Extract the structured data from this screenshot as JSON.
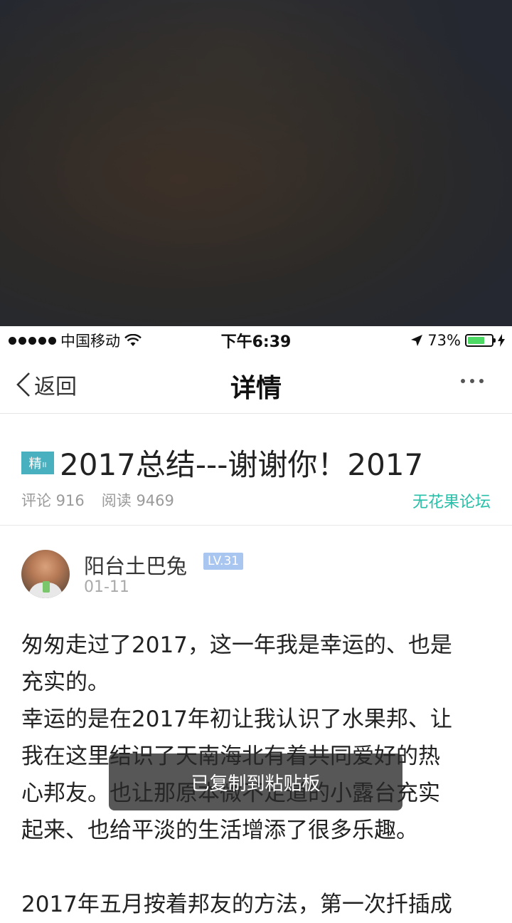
{
  "status_bar": {
    "carrier": "中国移动",
    "time": "下午6:39",
    "battery_percent": "73%",
    "battery_level": 0.73,
    "battery_color": "#4cd964"
  },
  "nav": {
    "back_label": "返回",
    "title": "详情",
    "more_icon": "ellipsis-icon"
  },
  "post": {
    "badge_main": "精",
    "badge_sub": "II",
    "badge_color": "#48b0bf",
    "title": "2017总结---谢谢你！2017",
    "comments_label": "评论 916",
    "reads_label": "阅读 9469",
    "forum": "无花果论坛",
    "forum_color": "#28bfa8"
  },
  "author": {
    "name": "阳台土巴兔",
    "level": "LV.31",
    "date": "01-11"
  },
  "content": {
    "lines": [
      "匆匆走过了2017，这一年我是幸运的、也是",
      "充实的。",
      "幸运的是在2017年初让我认识了水果邦、让",
      "我在这里结识了天南海北有着共同爱好的热",
      "心邦友。也让那原本微不足道的小露台充实",
      "起来、也给平淡的生活增添了很多乐趣。",
      "",
      "2017年五月按着邦友的方法，第一次扦插成"
    ]
  },
  "toast": {
    "text": "已复制到粘贴板"
  }
}
